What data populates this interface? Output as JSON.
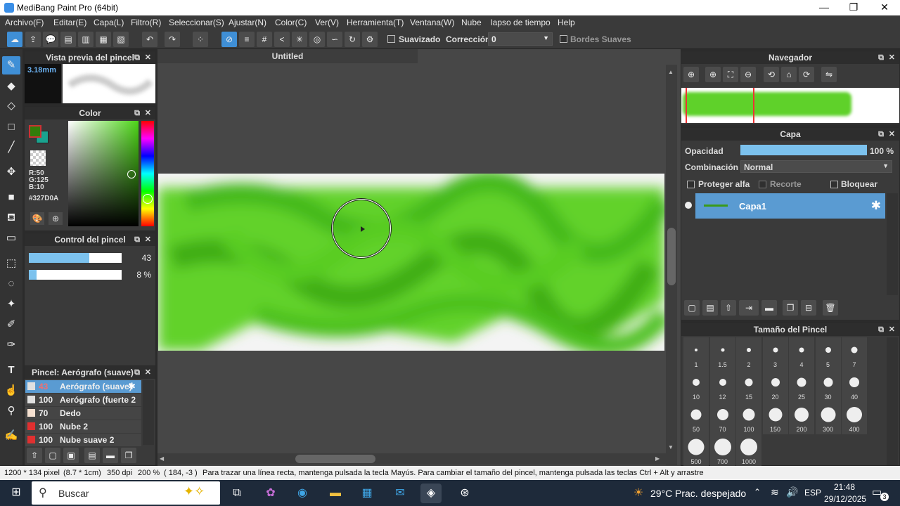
{
  "window": {
    "title": "MediBang Paint Pro (64bit)"
  },
  "menu": [
    "Archivo(F)",
    "Editar(E)",
    "Capa(L)",
    "Filtro(R)",
    "Seleccionar(S)",
    "Ajustar(N)",
    "Color(C)",
    "Ver(V)",
    "Herramienta(T)",
    "Ventana(W)",
    "Nube",
    "lapso de tiempo",
    "Help"
  ],
  "toolbar": {
    "smoothing_label": "Suavizado",
    "correction_label": "Corrección",
    "correction_value": "0",
    "soft_edges_label": "Bordes Suaves"
  },
  "brush_preview": {
    "title": "Vista previa del pincel",
    "size_text": "3.18mm"
  },
  "color_panel": {
    "title": "Color",
    "r": "R:50",
    "g": "G:125",
    "b": "B:10",
    "hex": "#327D0A",
    "primary": "#327D0A",
    "secondary": "#1aa38f"
  },
  "brush_control": {
    "title": "Control del pincel",
    "size_value": "43",
    "size_fraction": 0.65,
    "opacity_value": "8 %",
    "opacity_fraction": 0.08
  },
  "brush_list": {
    "title": "Pincel: Aerógrafo (suave)",
    "items": [
      {
        "num": "43",
        "name": "Aerógrafo (suave)",
        "color": "#e0e0e0"
      },
      {
        "num": "100",
        "name": "Aerógrafo (fuerte 2",
        "color": "#e0e0e0"
      },
      {
        "num": "70",
        "name": "Dedo",
        "color": "#f5e0d0"
      },
      {
        "num": "100",
        "name": "Nube 2",
        "color": "#e03030"
      },
      {
        "num": "100",
        "name": "Nube suave 2",
        "color": "#e03030"
      }
    ]
  },
  "document": {
    "tab_label": "Untitled"
  },
  "navigator": {
    "title": "Navegador"
  },
  "layers": {
    "title": "Capa",
    "opacity_label": "Opacidad",
    "opacity_value": "100 %",
    "opacity_fraction": 1.0,
    "blend_label": "Combinación",
    "blend_value": "Normal",
    "protect_alpha": "Proteger alfa",
    "clipping": "Recorte",
    "lock": "Bloquear",
    "items": [
      {
        "name": "Capa1"
      }
    ]
  },
  "brush_size": {
    "title": "Tamaño del Pincel",
    "sizes": [
      "1",
      "1.5",
      "2",
      "3",
      "4",
      "5",
      "7",
      "10",
      "12",
      "15",
      "20",
      "25",
      "30",
      "40",
      "50",
      "70",
      "100",
      "150",
      "200",
      "300",
      "400",
      "500",
      "700",
      "1000"
    ]
  },
  "status": {
    "dims": "1200 * 134 pixel",
    "physical": "(8.7 * 1cm)",
    "dpi": "350 dpi",
    "zoom": "200 %",
    "coords": "( 184, -3 )",
    "hint": "Para trazar una línea recta, mantenga pulsada la tecla Mayús. Para cambiar el tamaño del pincel, mantenga pulsada las teclas Ctrl + Alt y arrastre"
  },
  "taskbar": {
    "search_placeholder": "Buscar",
    "weather": "29°C",
    "weather_desc": "Prac. despejado",
    "lang": "ESP",
    "time": "21:48",
    "date": "29/12/2025",
    "notif": "3"
  }
}
